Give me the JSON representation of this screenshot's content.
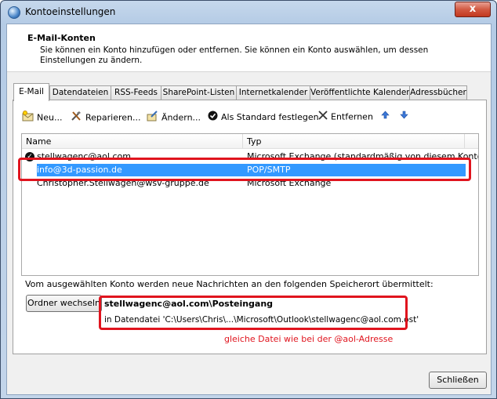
{
  "window": {
    "title": "Kontoeinstellungen",
    "close_glyph": "x"
  },
  "header": {
    "title": "E-Mail-Konten",
    "description": "Sie können ein Konto hinzufügen oder entfernen. Sie können ein Konto auswählen, um dessen Einstellungen zu ändern."
  },
  "tabs": [
    "E-Mail",
    "Datendateien",
    "RSS-Feeds",
    "SharePoint-Listen",
    "Internetkalender",
    "Veröffentlichte Kalender",
    "Adressbücher"
  ],
  "toolbar": {
    "new": "Neu...",
    "repair": "Reparieren...",
    "change": "Ändern...",
    "set_default": "Als Standard festlegen",
    "remove": "Entfernen",
    "up_icon": "arrow-up-icon",
    "down_icon": "arrow-down-icon"
  },
  "list": {
    "col_name": "Name",
    "col_type": "Typ",
    "rows": [
      {
        "name": "stellwagenc@aol.com",
        "type": "Microsoft Exchange (standardmäßig von diesem Konto",
        "default": true,
        "selected": false
      },
      {
        "name": "info@3d-passion.de",
        "type": "POP/SMTP",
        "default": false,
        "selected": true
      },
      {
        "name": "Christopher.Stellwagen@wsv-gruppe.de",
        "type": "Microsoft Exchange",
        "default": false,
        "selected": false
      }
    ]
  },
  "delivery": {
    "info": "Vom ausgewählten Konto werden neue Nachrichten an den folgenden Speicherort übermittelt:",
    "change_folder": "Ordner wechseln",
    "store": "stellwagenc@aol.com\\Posteingang",
    "path": "in Datendatei 'C:\\Users\\Chris\\...\\Microsoft\\Outlook\\stellwagenc@aol.com.ost'",
    "annotation": "gleiche Datei wie bei der @aol-Adresse"
  },
  "footer": {
    "close": "Schließen"
  },
  "colors": {
    "selection": "#3399ff",
    "annotation_red": "#e0141e",
    "close_red": "#c2381f"
  }
}
